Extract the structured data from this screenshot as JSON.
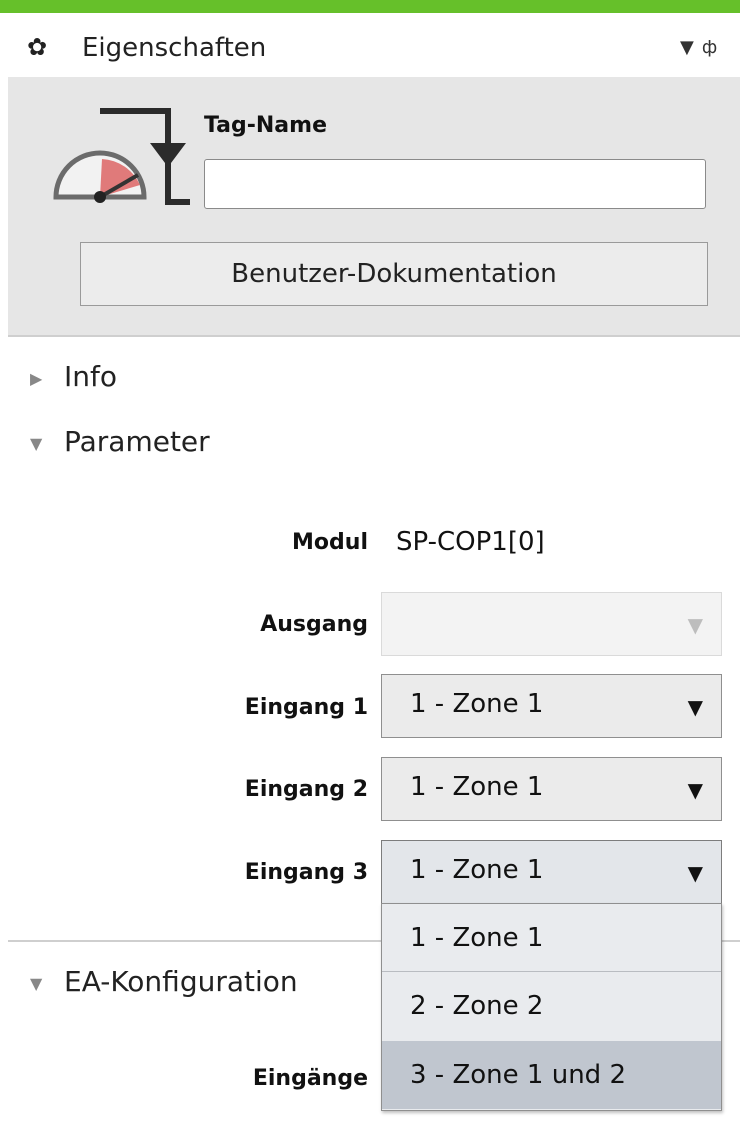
{
  "panel": {
    "title": "Eigenschaften",
    "gear_icon": "gear-icon",
    "dropdown_icon": "pin-dropdown",
    "pin_icon": "pin-icon"
  },
  "header": {
    "tag_label": "Tag-Name",
    "tag_value": "",
    "doc_button": "Benutzer-Dokumentation",
    "icon": "gauge-tag-icon"
  },
  "sections": {
    "info": "Info",
    "parameter": "Parameter",
    "ea": "EA-Konfiguration"
  },
  "parameter": {
    "modul_label": "Modul",
    "modul_value": "SP-COP1[0]",
    "ausgang_label": "Ausgang",
    "ausgang_value": "",
    "eingang1_label": "Eingang 1",
    "eingang1_value": "1 - Zone 1",
    "eingang2_label": "Eingang 2",
    "eingang2_value": "1 - Zone 1",
    "eingang3_label": "Eingang 3",
    "eingang3_value": "1 - Zone 1"
  },
  "ea": {
    "eingaenge_label": "Eingänge"
  },
  "dropdown": {
    "options": [
      "1 - Zone 1",
      "2 - Zone 2",
      "3 - Zone 1 und 2"
    ],
    "highlighted": "3 - Zone 1 und 2"
  },
  "colors": {
    "accent": "#66c02a",
    "header_bg": "#e6e6e6",
    "highlight": "#c0c6cf"
  }
}
